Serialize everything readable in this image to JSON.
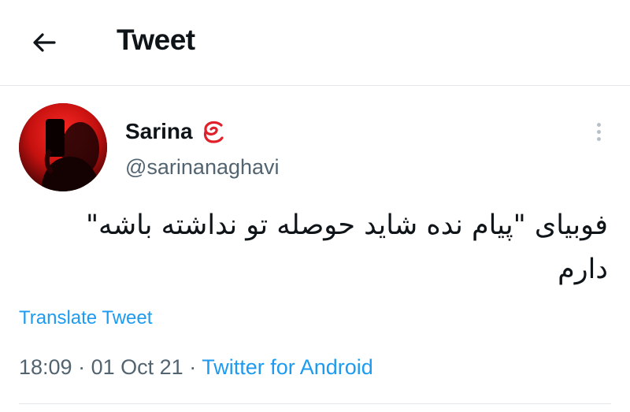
{
  "header": {
    "back_icon": "arrow-left-icon",
    "title": "Tweet"
  },
  "tweet": {
    "author": {
      "display_name": "Sarina",
      "name_emoji_icon": "red-curl-emoji",
      "handle": "@sarinanaghavi",
      "avatar": "profile-photo"
    },
    "more_icon": "vertical-ellipsis-icon",
    "text_line_1": "فوبیای \"پیام نده شاید حوصله تو نداشته باشه\"",
    "text_line_2": "دارم",
    "translate_label": "Translate Tweet",
    "time": "18:09",
    "date": "01 Oct 21",
    "separator": "·",
    "source": "Twitter for Android"
  },
  "colors": {
    "accent": "#1d9bf0",
    "secondary_text": "#536471",
    "divider": "#e6e9ec"
  }
}
